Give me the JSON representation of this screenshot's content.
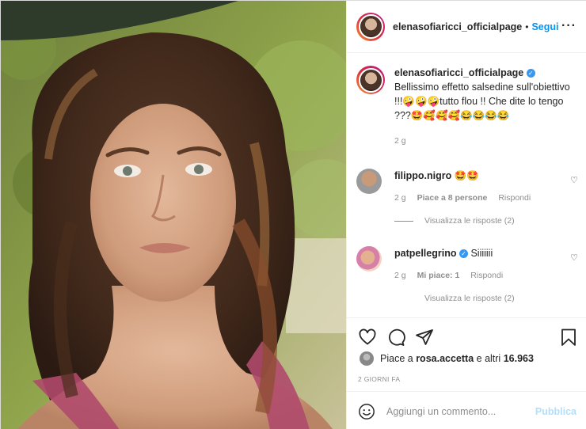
{
  "post": {
    "photo_alt": "",
    "author": {
      "username": "elenasofiaricci_officialpage",
      "follow_label": "Segui",
      "dot": "•"
    },
    "caption": {
      "username": "elenasofiaricci_officialpage",
      "verified_mark": "✓",
      "text": "Bellissimo effetto salsedine sull'obiettivo !!!🤪🤪🤪tutto flou !! Che dite lo tengo ???🤩🥰🥰🥰😂😂😂😂",
      "time": "2 g"
    },
    "comments": [
      {
        "username": "filippo.nigro",
        "verified": false,
        "text": "🤩🤩",
        "time": "2 g",
        "likes": "Piace a 8 persone",
        "reply": "Rispondi",
        "view_replies": "Visualizza le risposte (2)"
      },
      {
        "username": "patpellegrino",
        "verified": true,
        "text": "Siiiiiii",
        "time": "2 g",
        "likes": "Mi piace: 1",
        "reply": "Rispondi",
        "view_replies": "Visualizza le risposte (2)"
      }
    ],
    "likes_prefix": "Piace a",
    "likes_user": "rosa.accetta",
    "likes_middle": "e altri",
    "likes_count": "16.963",
    "time_ago": "2 GIORNI FA",
    "add_comment_placeholder": "Aggiungi un commento...",
    "publish_label": "Pubblica"
  },
  "icons": {
    "more": "more-icon",
    "heart": "heart-icon",
    "comment": "comment-icon",
    "share": "share-icon",
    "save": "bookmark-icon",
    "emoji": "emoji-icon"
  },
  "colors": {
    "accent": "#0095f6",
    "publish_disabled": "#b2dffc",
    "muted": "#8e8e8e",
    "verified": "#3897f0"
  }
}
